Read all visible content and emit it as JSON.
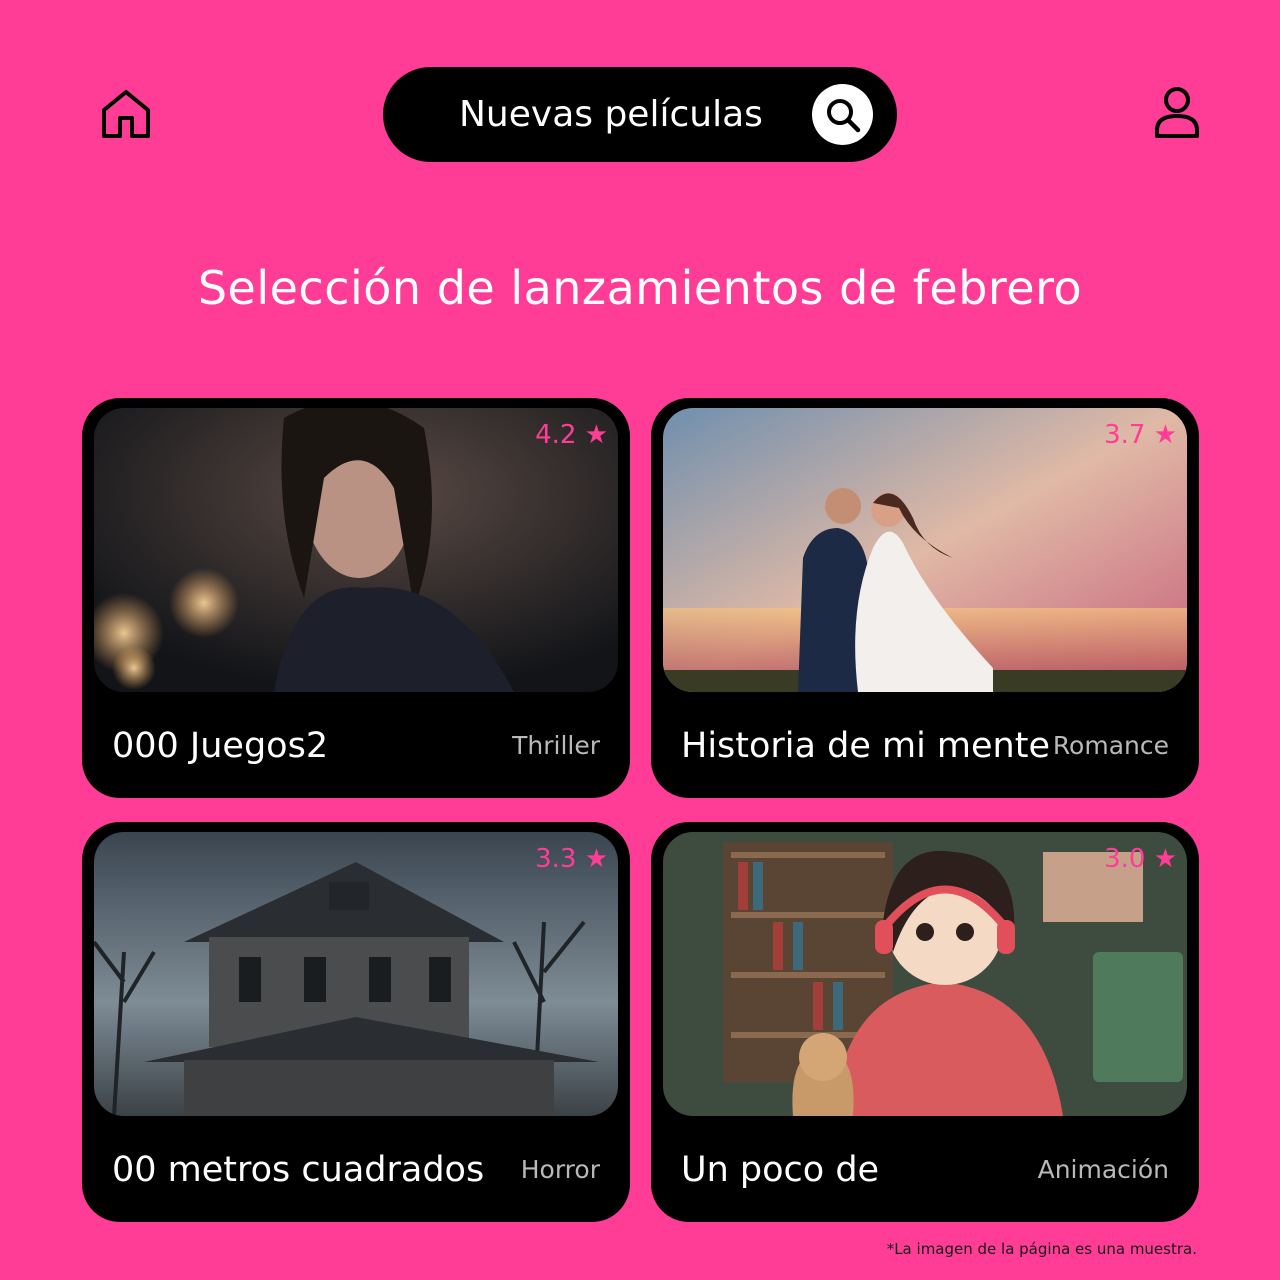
{
  "header": {
    "home_icon": "home-icon",
    "search_label": "Nuevas películas",
    "search_icon": "search-icon",
    "profile_icon": "user-icon"
  },
  "heading": "Selección de lanzamientos de febrero",
  "accent_color": "#ff3d96",
  "movies": [
    {
      "title": "000 Juegos2",
      "genre": "Thriller",
      "rating": "4.2 ★"
    },
    {
      "title": "Historia de mi mente",
      "genre": "Romance",
      "rating": "3.7 ★"
    },
    {
      "title": "00 metros cuadrados",
      "genre": "Horror",
      "rating": "3.3 ★"
    },
    {
      "title": "Un poco de",
      "genre": "Animación",
      "rating": "3.0 ★"
    }
  ],
  "footnote": "*La imagen de la página es una muestra."
}
